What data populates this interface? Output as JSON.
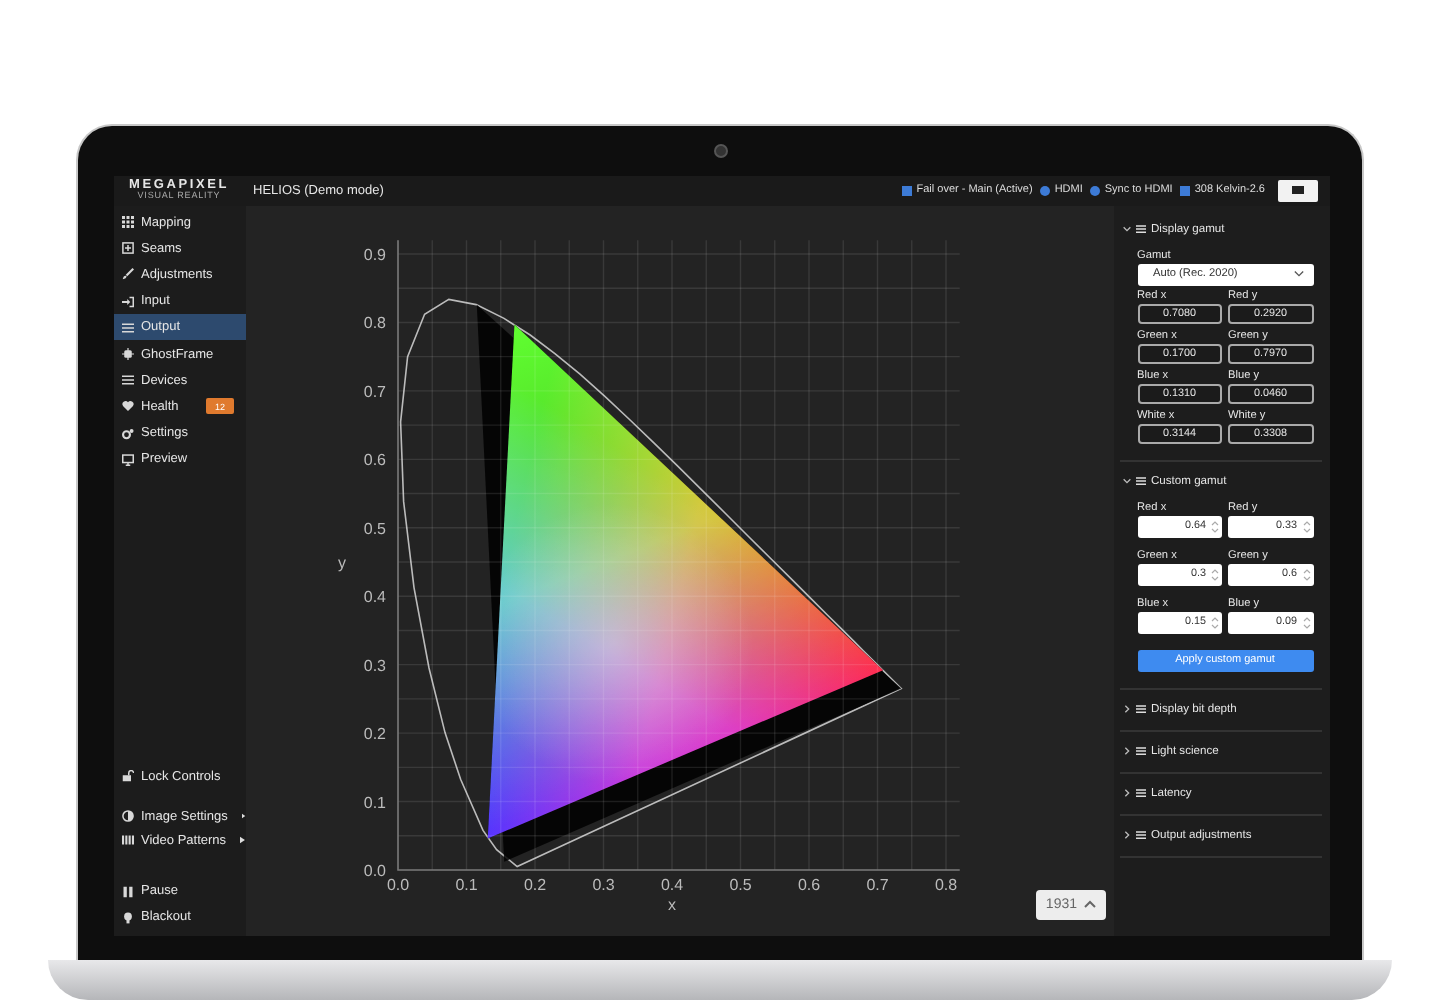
{
  "header": {
    "logo": "MEGAPIXEL",
    "tagline": "VISUAL REALITY",
    "title": "HELIOS (Demo mode)",
    "status": [
      {
        "kind": "square",
        "label": "Fail over - Main (Active)"
      },
      {
        "kind": "dot",
        "label": "HDMI"
      },
      {
        "kind": "dot",
        "label": "Sync to HDMI"
      },
      {
        "kind": "square",
        "label": "308 Kelvin-2.6"
      }
    ]
  },
  "sidebar": {
    "items": [
      {
        "label": "Mapping",
        "selected": false
      },
      {
        "label": "Seams",
        "selected": false
      },
      {
        "label": "Adjustments",
        "selected": false
      },
      {
        "label": "Input",
        "selected": false
      },
      {
        "label": "Output",
        "selected": true
      },
      {
        "label": "GhostFrame",
        "selected": false
      },
      {
        "label": "Devices",
        "selected": false
      },
      {
        "label": "Health",
        "selected": false,
        "badge": "12"
      },
      {
        "label": "Settings",
        "selected": false
      },
      {
        "label": "Preview",
        "selected": false
      }
    ],
    "controls": [
      {
        "label": "Lock Controls",
        "submenu": false
      },
      {
        "label": "Image Settings",
        "submenu": true
      },
      {
        "label": "Video Patterns",
        "submenu": true
      }
    ],
    "actions": [
      {
        "label": "Pause"
      },
      {
        "label": "Blackout"
      }
    ]
  },
  "chart_data": {
    "type": "line",
    "grid": true,
    "xlabel": "x",
    "ylabel": "y",
    "xlim": [
      0,
      0.8
    ],
    "ylim": [
      0,
      0.9
    ],
    "xticks": [
      {
        "value": 0,
        "label": "0.0"
      },
      {
        "value": 0.1,
        "label": "0.1"
      },
      {
        "value": 0.2,
        "label": "0.2"
      },
      {
        "value": 0.3,
        "label": "0.3"
      },
      {
        "value": 0.4,
        "label": "0.4"
      },
      {
        "value": 0.5,
        "label": "0.5"
      },
      {
        "value": 0.6,
        "label": "0.6"
      },
      {
        "value": 0.7,
        "label": "0.7"
      },
      {
        "value": 0.8,
        "label": "0.8"
      }
    ],
    "yticks": [
      {
        "value": 0,
        "label": "0.0"
      },
      {
        "value": 0.1,
        "label": "0.1"
      },
      {
        "value": 0.2,
        "label": "0.2"
      },
      {
        "value": 0.3,
        "label": "0.3"
      },
      {
        "value": 0.4,
        "label": "0.4"
      },
      {
        "value": 0.5,
        "label": "0.5"
      },
      {
        "value": 0.6,
        "label": "0.6"
      },
      {
        "value": 0.7,
        "label": "0.7"
      },
      {
        "value": 0.8,
        "label": "0.8"
      },
      {
        "value": 0.9,
        "label": "0.9"
      }
    ]
  },
  "diagram_toggle": {
    "label": "1931"
  },
  "panel": {
    "sections": [
      {
        "kind": "display",
        "title": "Display gamut",
        "expanded": true,
        "select": {
          "label": "Gamut",
          "value": "Auto (Rec. 2020)"
        },
        "fields": [
          {
            "label": "Red x",
            "value": "0.7080"
          },
          {
            "label": "Red y",
            "value": "0.2920"
          },
          {
            "label": "Green x",
            "value": "0.1700"
          },
          {
            "label": "Green y",
            "value": "0.7970"
          },
          {
            "label": "Blue x",
            "value": "0.1310"
          },
          {
            "label": "Blue y",
            "value": "0.0460"
          },
          {
            "label": "White x",
            "value": "0.3144"
          },
          {
            "label": "White y",
            "value": "0.3308"
          }
        ]
      },
      {
        "kind": "custom",
        "title": "Custom gamut",
        "expanded": true,
        "fields": [
          {
            "label": "Red x",
            "value": "0.64"
          },
          {
            "label": "Red y",
            "value": "0.33"
          },
          {
            "label": "Green x",
            "value": "0.3"
          },
          {
            "label": "Green y",
            "value": "0.6"
          },
          {
            "label": "Blue x",
            "value": "0.15"
          },
          {
            "label": "Blue y",
            "value": "0.09"
          }
        ],
        "button": "Apply custom gamut"
      },
      {
        "kind": "plain",
        "title": "Display bit depth",
        "expanded": false
      },
      {
        "kind": "plain",
        "title": "Light science",
        "expanded": false
      },
      {
        "kind": "plain",
        "title": "Latency",
        "expanded": false
      },
      {
        "kind": "plain",
        "title": "Output adjustments",
        "expanded": false
      }
    ]
  }
}
